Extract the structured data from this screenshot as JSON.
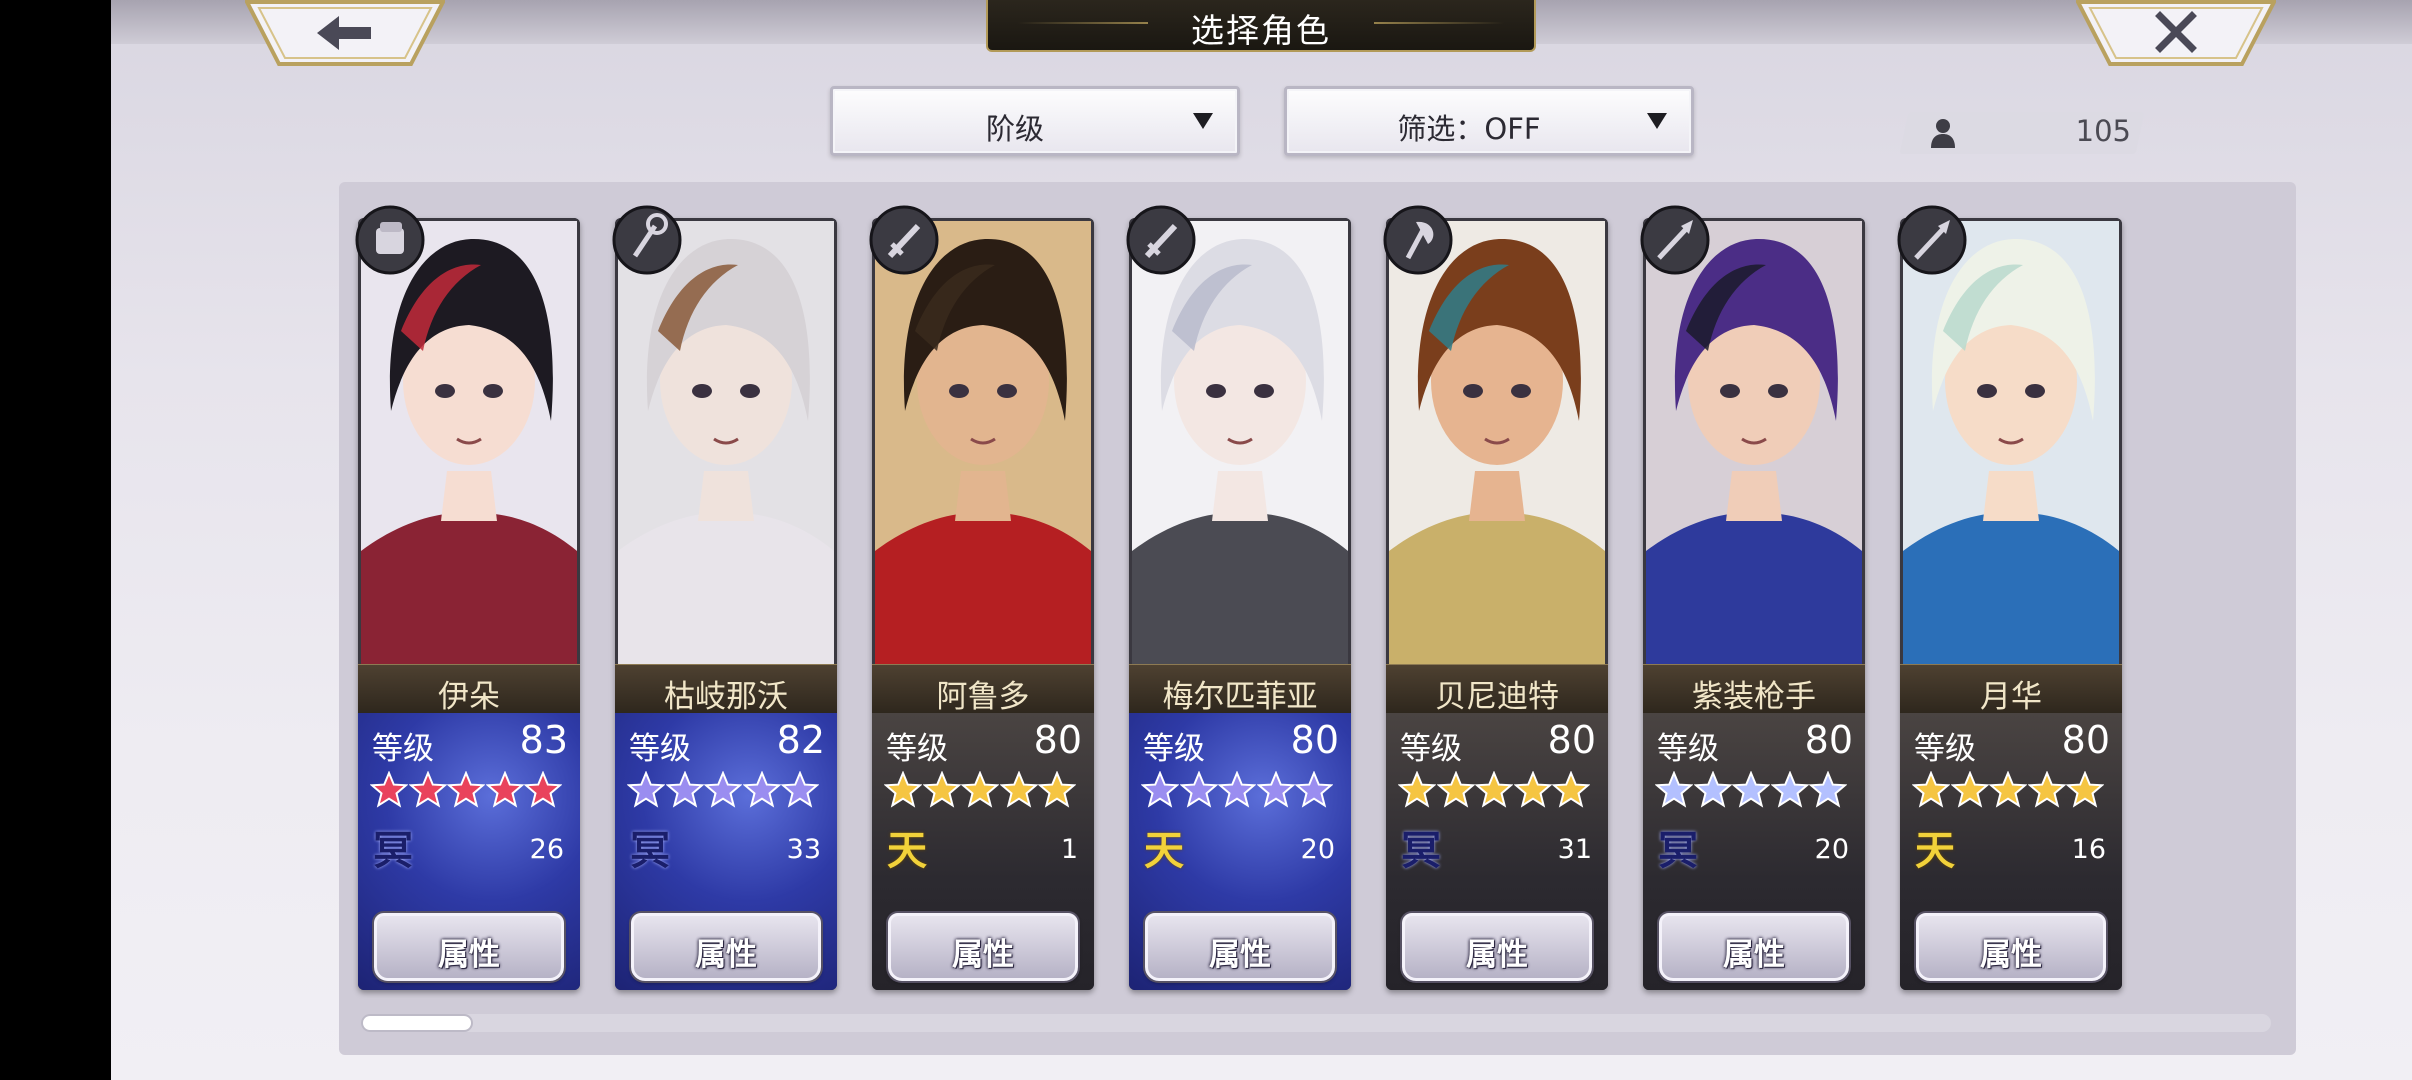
{
  "header": {
    "title": "选择角色",
    "back_icon": "arrow-left-icon",
    "close_icon": "close-x-icon"
  },
  "toolbar": {
    "sort_label": "阶级",
    "filter_label": "筛选：OFF",
    "character_count": "105"
  },
  "colors": {
    "star_red": "#e9435c",
    "star_purple": "#9a8df0",
    "star_gold": "#f5c542",
    "star_blue": "#b3c0ff",
    "info_blue": "#2e3aa6",
    "tag_dark": "#1a1e6a",
    "tag_sky": "#f2d23a"
  },
  "cards": [
    {
      "name": "伊朵",
      "level_label": "等级",
      "level": "83",
      "star_color": "red",
      "tag": "冥",
      "tag_type": "dark",
      "count": "26",
      "weapon": "gauntlet-icon",
      "attr_label": "属性",
      "panel": "blue"
    },
    {
      "name": "枯岐那沃",
      "level_label": "等级",
      "level": "82",
      "star_color": "purple",
      "tag": "冥",
      "tag_type": "dark",
      "count": "33",
      "weapon": "staff-icon",
      "attr_label": "属性",
      "panel": "blue"
    },
    {
      "name": "阿鲁多",
      "level_label": "等级",
      "level": "80",
      "star_color": "gold",
      "tag": "天",
      "tag_type": "sky",
      "count": "1",
      "weapon": "sword-icon",
      "attr_label": "属性",
      "panel": "dark"
    },
    {
      "name": "梅尔匹菲亚",
      "level_label": "等级",
      "level": "80",
      "star_color": "purple",
      "tag": "天",
      "tag_type": "sky",
      "count": "20",
      "weapon": "sword-icon",
      "attr_label": "属性",
      "panel": "blue"
    },
    {
      "name": "贝尼迪特",
      "level_label": "等级",
      "level": "80",
      "star_color": "gold",
      "tag": "冥",
      "tag_type": "dark",
      "count": "31",
      "weapon": "axe-icon",
      "attr_label": "属性",
      "panel": "dark"
    },
    {
      "name": "紫装枪手",
      "level_label": "等级",
      "level": "80",
      "star_color": "blue",
      "tag": "冥",
      "tag_type": "dark",
      "count": "20",
      "weapon": "spear-icon",
      "attr_label": "属性",
      "panel": "dark"
    },
    {
      "name": "月华",
      "level_label": "等级",
      "level": "80",
      "star_color": "gold",
      "tag": "天",
      "tag_type": "sky",
      "count": "16",
      "weapon": "spear-icon",
      "attr_label": "属性",
      "panel": "dark"
    }
  ],
  "scroll": {
    "position": 0.0
  }
}
